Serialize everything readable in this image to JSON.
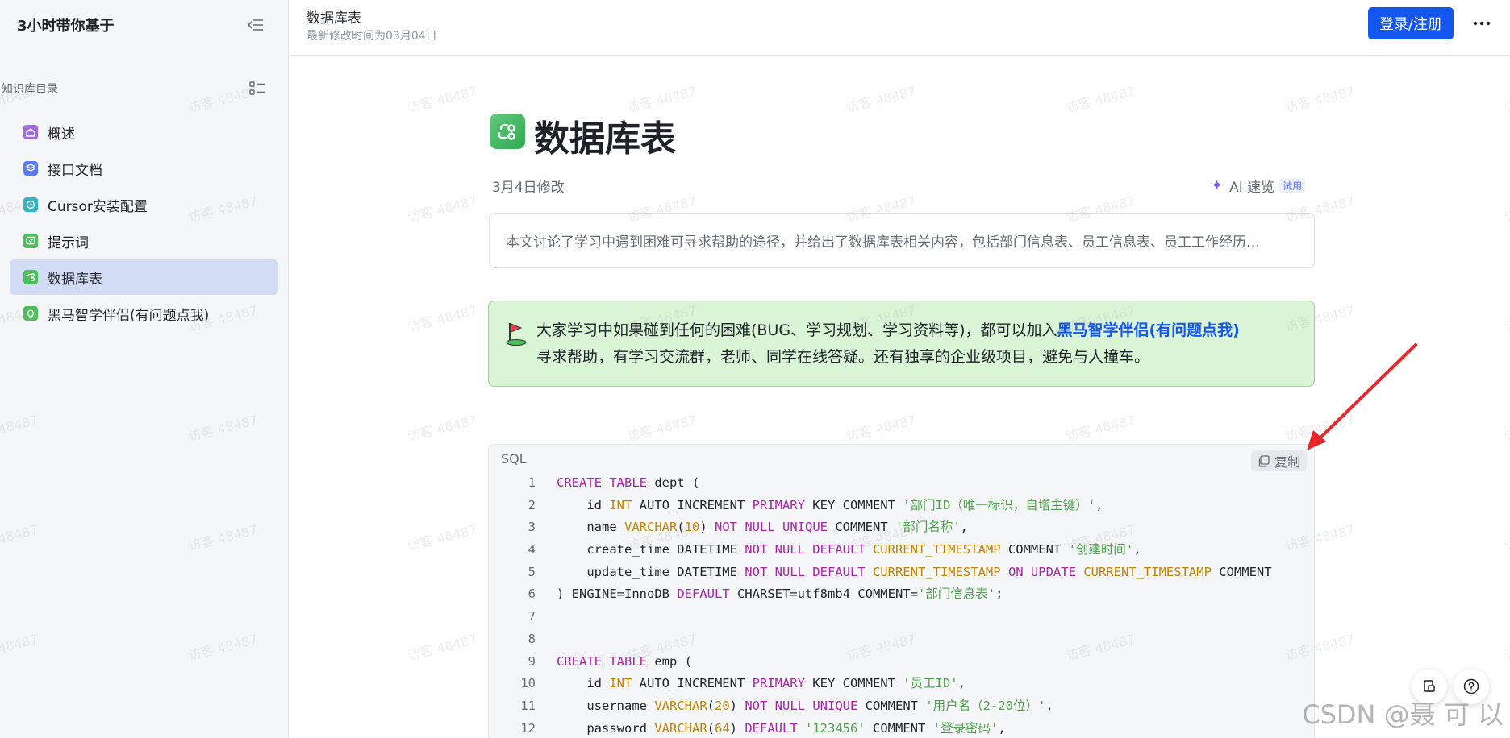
{
  "sidebar": {
    "title": "3小时带你基于",
    "section_label": "知识库目录",
    "items": [
      {
        "label": "概述",
        "icon": "home-doc-icon",
        "color": "#a16bdf",
        "active": false
      },
      {
        "label": "接口文档",
        "icon": "layers-doc-icon",
        "color": "#5b7cf0",
        "active": false
      },
      {
        "label": "Cursor安装配置",
        "icon": "compass-doc-icon",
        "color": "#31b8c4",
        "active": false
      },
      {
        "label": "提示词",
        "icon": "chat-doc-icon",
        "color": "#4cbf5a",
        "active": false
      },
      {
        "label": "数据库表",
        "icon": "share-doc-icon",
        "color": "#4cbf5a",
        "active": true
      },
      {
        "label": "黑马智学伴侣(有问题点我)",
        "icon": "bulb-doc-icon",
        "color": "#4cbf5a",
        "active": false
      }
    ]
  },
  "topbar": {
    "title": "数据库表",
    "subtitle": "最新修改时间为03月04日",
    "login_label": "登录/注册"
  },
  "doc": {
    "title": "数据库表",
    "modified": "3月4日修改",
    "ai_label": "AI 速览",
    "trial_badge": "试用",
    "summary": "本文讨论了学习中遇到困难可寻求帮助的途径，并给出了数据库表相关内容，包括部门信息表、员工信息表、员工工作经历…",
    "callout_text_1": "大家学习中如果碰到任何的困难(BUG、学习规划、学习资料等)，都可以加入",
    "callout_link": "黑马智学伴侣(有问题点我)",
    "callout_text_2": "寻求帮助，有学习交流群，老师、同学在线答疑。还有独享的企业级项目，避免与人撞车。"
  },
  "code": {
    "language": "SQL",
    "copy_label": "复制",
    "lines": [
      [
        [
          "kw",
          "CREATE TABLE"
        ],
        [
          "p",
          " dept ("
        ]
      ],
      [
        [
          "p",
          "    id "
        ],
        [
          "ty",
          "INT"
        ],
        [
          "p",
          " AUTO_INCREMENT "
        ],
        [
          "kw",
          "PRIMARY"
        ],
        [
          "p",
          " KEY COMMENT "
        ],
        [
          "st",
          "'部门ID（唯一标识，自增主键）'"
        ],
        [
          "p",
          ","
        ]
      ],
      [
        [
          "p",
          "    name "
        ],
        [
          "ty",
          "VARCHAR"
        ],
        [
          "p",
          "("
        ],
        [
          "ty",
          "10"
        ],
        [
          "p",
          ") "
        ],
        [
          "kw",
          "NOT NULL UNIQUE"
        ],
        [
          "p",
          " COMMENT "
        ],
        [
          "st",
          "'部门名称'"
        ],
        [
          "p",
          ","
        ]
      ],
      [
        [
          "p",
          "    create_time DATETIME "
        ],
        [
          "kw",
          "NOT NULL DEFAULT"
        ],
        [
          "p",
          " "
        ],
        [
          "ty",
          "CURRENT_TIMESTAMP"
        ],
        [
          "p",
          " COMMENT "
        ],
        [
          "st",
          "'创建时间'"
        ],
        [
          "p",
          ","
        ]
      ],
      [
        [
          "p",
          "    update_time DATETIME "
        ],
        [
          "kw",
          "NOT NULL DEFAULT"
        ],
        [
          "p",
          " "
        ],
        [
          "ty",
          "CURRENT_TIMESTAMP"
        ],
        [
          "p",
          " "
        ],
        [
          "kw",
          "ON UPDATE"
        ],
        [
          "p",
          " "
        ],
        [
          "ty",
          "CURRENT_TIMESTAMP"
        ],
        [
          "p",
          " COMMENT"
        ]
      ],
      [
        [
          "p",
          ") ENGINE=InnoDB "
        ],
        [
          "kw",
          "DEFAULT"
        ],
        [
          "p",
          " CHARSET=utf8mb4 COMMENT="
        ],
        [
          "st",
          "'部门信息表'"
        ],
        [
          "p",
          ";"
        ]
      ],
      [],
      [],
      [
        [
          "kw",
          "CREATE TABLE"
        ],
        [
          "p",
          " emp ("
        ]
      ],
      [
        [
          "p",
          "    id "
        ],
        [
          "ty",
          "INT"
        ],
        [
          "p",
          " AUTO_INCREMENT "
        ],
        [
          "kw",
          "PRIMARY"
        ],
        [
          "p",
          " KEY COMMENT "
        ],
        [
          "st",
          "'员工ID'"
        ],
        [
          "p",
          ","
        ]
      ],
      [
        [
          "p",
          "    username "
        ],
        [
          "ty",
          "VARCHAR"
        ],
        [
          "p",
          "("
        ],
        [
          "ty",
          "20"
        ],
        [
          "p",
          ") "
        ],
        [
          "kw",
          "NOT NULL UNIQUE"
        ],
        [
          "p",
          " COMMENT "
        ],
        [
          "st",
          "'用户名（2-20位）'"
        ],
        [
          "p",
          ","
        ]
      ],
      [
        [
          "p",
          "    password "
        ],
        [
          "ty",
          "VARCHAR"
        ],
        [
          "p",
          "("
        ],
        [
          "ty",
          "64"
        ],
        [
          "p",
          ") "
        ],
        [
          "kw",
          "DEFAULT"
        ],
        [
          "p",
          " "
        ],
        [
          "st",
          "'123456'"
        ],
        [
          "p",
          " COMMENT "
        ],
        [
          "st",
          "'登录密码'"
        ],
        [
          "p",
          ","
        ]
      ]
    ]
  },
  "watermark": "访客 48487",
  "csdn_watermark": "CSDN @聂 可 以"
}
